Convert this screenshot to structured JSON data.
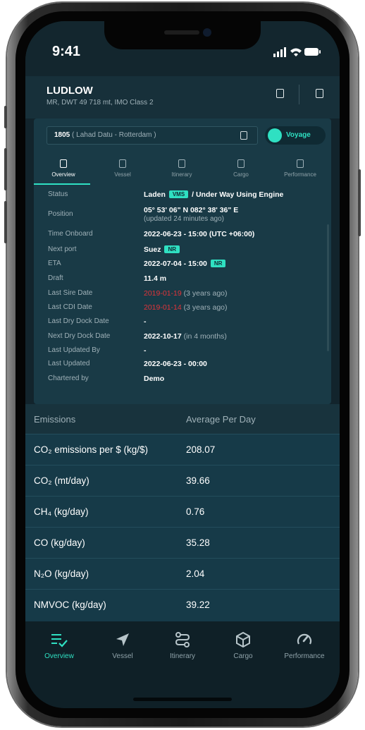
{
  "status_bar": {
    "time": "9:41"
  },
  "header": {
    "vessel_name": "LUDLOW",
    "vessel_info": "MR, DWT 49 718 mt, IMO Class 2"
  },
  "voyage": {
    "number": "1805",
    "route": "( Lahad Datu - Rotterdam )",
    "toggle_label": "Voyage"
  },
  "tabs": [
    {
      "label": "Overview"
    },
    {
      "label": "Vessel"
    },
    {
      "label": "Itinerary"
    },
    {
      "label": "Cargo"
    },
    {
      "label": "Performance"
    }
  ],
  "details": {
    "status": {
      "label": "Status",
      "value": "Laden",
      "badge": "VMS",
      "rest": "/ Under Way Using Engine"
    },
    "position": {
      "label": "Position",
      "value": "05° 53' 06\" N 082° 38' 36\" E",
      "note": "(updated 24 minutes ago)"
    },
    "time_onboard": {
      "label": "Time Onboard",
      "value": "2022-06-23 - 15:00 (UTC +06:00)"
    },
    "next_port": {
      "label": "Next port",
      "value": "Suez",
      "badge": "NR"
    },
    "eta": {
      "label": "ETA",
      "value": "2022-07-04 - 15:00",
      "badge": "NR"
    },
    "draft": {
      "label": "Draft",
      "value": "11.4 m"
    },
    "last_sire": {
      "label": "Last Sire Date",
      "value": "2019-01-19",
      "note": "(3 years ago)"
    },
    "last_cdi": {
      "label": "Last CDI Date",
      "value": "2019-01-14",
      "note": "(3 years ago)"
    },
    "last_dry_dock": {
      "label": "Last Dry Dock Date",
      "value": "-"
    },
    "next_dry_dock": {
      "label": "Next Dry Dock Date",
      "value": "2022-10-17",
      "note": "(in 4 months)"
    },
    "last_updated_by": {
      "label": "Last Updated By",
      "value": "-"
    },
    "last_updated": {
      "label": "Last Updated",
      "value": "2022-06-23 - 00:00"
    },
    "chartered_by": {
      "label": "Chartered by",
      "value": "Demo"
    }
  },
  "emissions": {
    "header_left": "Emissions",
    "header_right": "Average Per Day",
    "rows": [
      {
        "name": "CO₂ emissions per $ (kg/$)",
        "value": "208.07"
      },
      {
        "name": "CO₂ (mt/day)",
        "value": "39.66"
      },
      {
        "name": "CH₄ (kg/day)",
        "value": "0.76"
      },
      {
        "name": "CO (kg/day)",
        "value": "35.28"
      },
      {
        "name": "N₂O (kg/day)",
        "value": "2.04"
      },
      {
        "name": "NMVOC (kg/day)",
        "value": "39.22"
      }
    ]
  },
  "bottom_nav": [
    {
      "label": "Overview",
      "icon": "list-check-icon"
    },
    {
      "label": "Vessel",
      "icon": "navigation-arrow-icon"
    },
    {
      "label": "Itinerary",
      "icon": "route-icon"
    },
    {
      "label": "Cargo",
      "icon": "box-icon"
    },
    {
      "label": "Performance",
      "icon": "gauge-icon"
    }
  ],
  "colors": {
    "accent": "#2fe0c2",
    "background": "#12242c",
    "warning": "#e0343a"
  }
}
